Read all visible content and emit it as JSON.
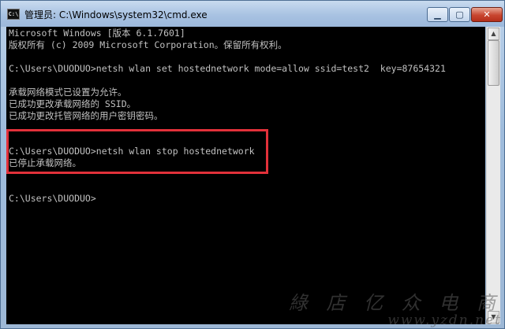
{
  "window": {
    "title": "管理员: C:\\Windows\\system32\\cmd.exe",
    "icon_text": "C:\\",
    "controls": {
      "minimize": "▁",
      "maximize": "▢",
      "close": "✕"
    }
  },
  "console": {
    "lines": [
      "Microsoft Windows [版本 6.1.7601]",
      "版权所有 (c) 2009 Microsoft Corporation。保留所有权利。",
      "",
      "C:\\Users\\DUODUO>netsh wlan set hostednetwork mode=allow ssid=test2  key=87654321",
      "",
      "承载网络模式已设置为允许。",
      "已成功更改承载网络的 SSID。",
      "已成功更改托管网络的用户密钥密码。",
      "",
      "",
      "C:\\Users\\DUODUO>netsh wlan stop hostednetwork",
      "已停止承载网络。",
      "",
      "",
      "C:\\Users\\DUODUO>"
    ]
  },
  "highlight_color": "#e2313a",
  "watermark": {
    "text_cn": "綠 店 亿 众 电 商",
    "url": "www.yzdn.net"
  }
}
